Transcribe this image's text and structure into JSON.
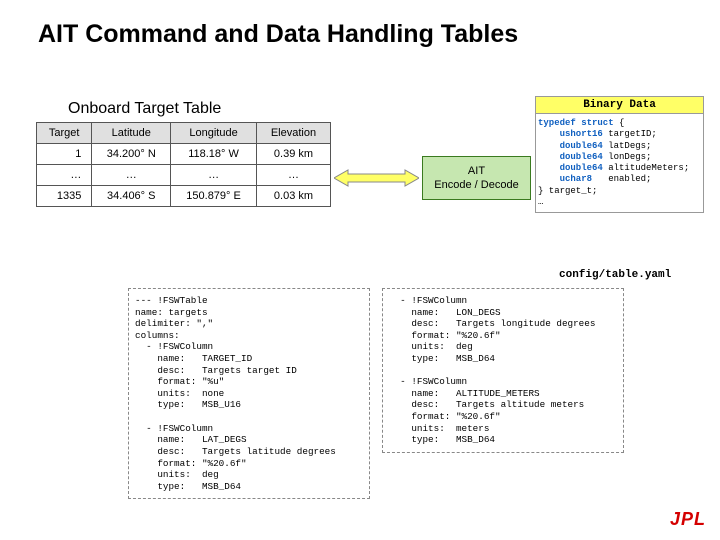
{
  "title": "AIT Command and Data Handling Tables",
  "onboard": {
    "caption": "Onboard Target Table",
    "headers": [
      "Target",
      "Latitude",
      "Longitude",
      "Elevation"
    ],
    "rows": [
      {
        "target": "1",
        "lat": "34.200° N",
        "lon": "118.18° W",
        "elev": "0.39 km"
      },
      {
        "target": "…",
        "lat": "…",
        "lon": "…",
        "elev": "…"
      },
      {
        "target": "1335",
        "lat": "34.406° S",
        "lon": "150.879° E",
        "elev": "0.03 km"
      }
    ]
  },
  "encode_box": "AIT\nEncode / Decode",
  "bindata": {
    "title": "Binary Data",
    "lines": [
      {
        "kw": "typedef struct",
        "rest": " {"
      },
      {
        "kw": "    ushort16",
        "rest": " targetID;"
      },
      {
        "kw": "    double64",
        "rest": " latDegs;"
      },
      {
        "kw": "    double64",
        "rest": " lonDegs;"
      },
      {
        "kw": "    double64",
        "rest": " altitudeMeters;"
      },
      {
        "kw": "    uchar8  ",
        "rest": " enabled;"
      },
      {
        "kw": "",
        "rest": "} target_t; "
      },
      {
        "kw": "",
        "rest": "…"
      }
    ]
  },
  "yaml": {
    "caption": "config/table.yaml",
    "left": "--- !FSWTable\nname: targets\ndelimiter: \",\"\ncolumns:\n  - !FSWColumn\n    name:   TARGET_ID\n    desc:   Targets target ID\n    format: \"%u\"\n    units:  none\n    type:   MSB_U16\n\n  - !FSWColumn\n    name:   LAT_DEGS\n    desc:   Targets latitude degrees\n    format: \"%20.6f\"\n    units:  deg\n    type:   MSB_D64",
    "right": "  - !FSWColumn\n    name:   LON_DEGS\n    desc:   Targets longitude degrees\n    format: \"%20.6f\"\n    units:  deg\n    type:   MSB_D64\n\n  - !FSWColumn\n    name:   ALTITUDE_METERS\n    desc:   Targets altitude meters\n    format: \"%20.6f\"\n    units:  meters\n    type:   MSB_D64"
  },
  "logo": "JPL"
}
